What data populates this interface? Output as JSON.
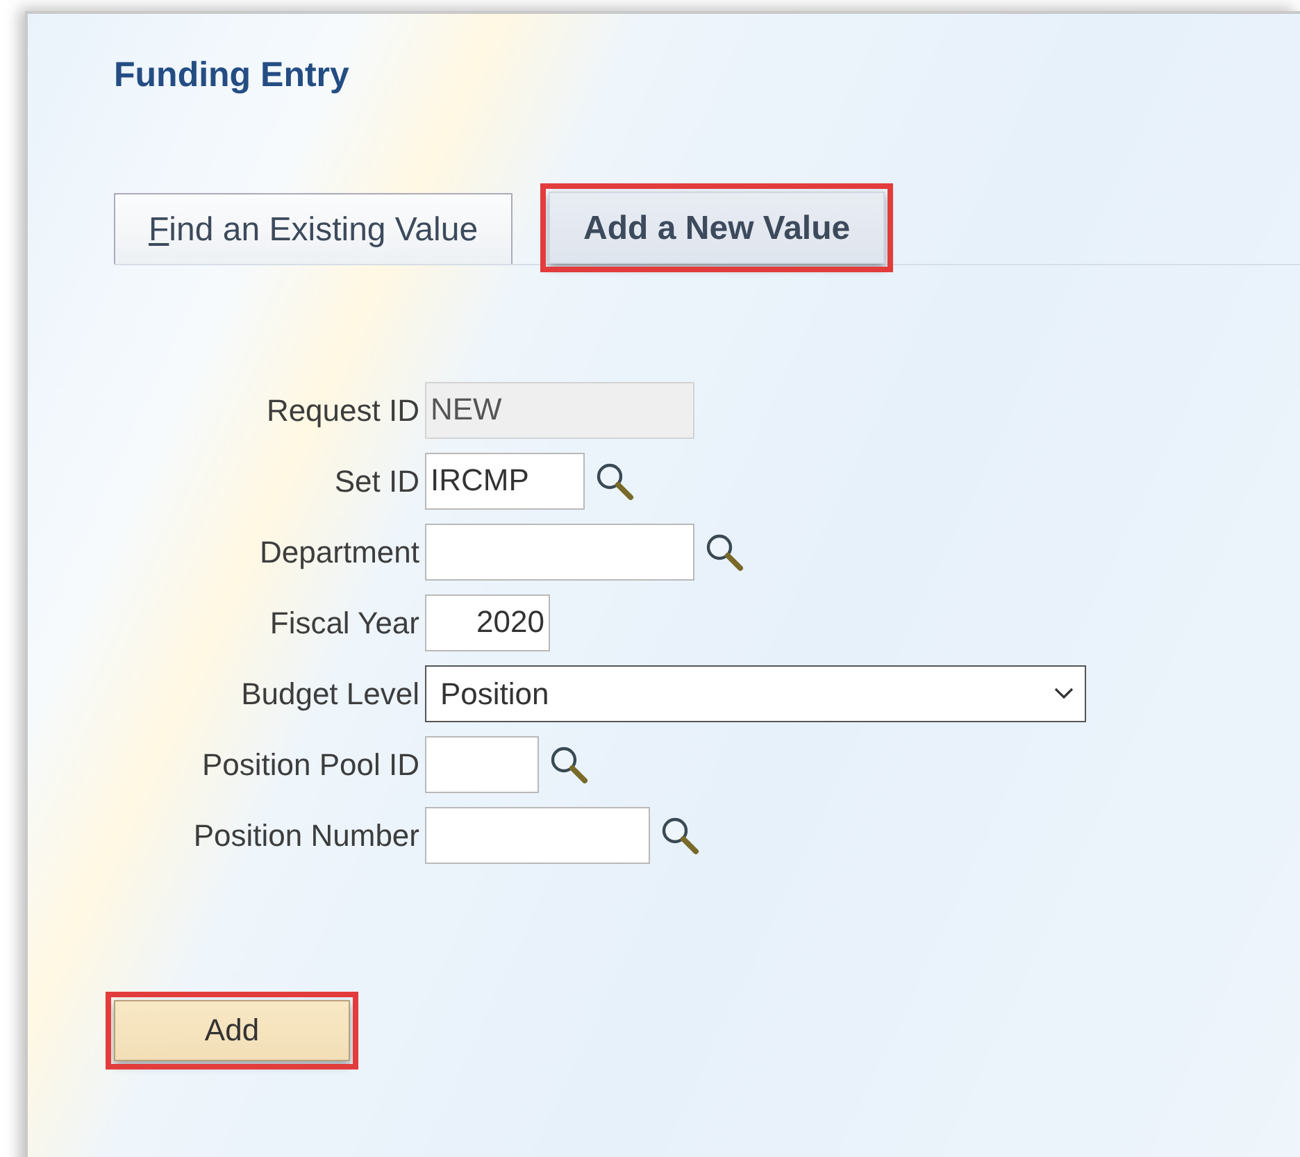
{
  "page": {
    "title": "Funding Entry"
  },
  "tabs": [
    {
      "label": "Find an Existing Value",
      "selected": false,
      "highlighted": false,
      "mnemonic_underlined": true
    },
    {
      "label": "Add a New Value",
      "selected": true,
      "highlighted": true,
      "mnemonic_underlined": false
    }
  ],
  "fields": [
    {
      "label": "Request ID",
      "kind": "text",
      "value": "NEW",
      "disabled": true,
      "lookup": false
    },
    {
      "label": "Set ID",
      "kind": "text",
      "value": "IRCMP",
      "disabled": false,
      "lookup": true
    },
    {
      "label": "Department",
      "kind": "text",
      "disabled": false,
      "lookup": true
    },
    {
      "label": "Fiscal Year",
      "kind": "text",
      "value": "2020",
      "disabled": false,
      "lookup": false
    },
    {
      "label": "Budget Level",
      "kind": "select",
      "value": "Position",
      "disabled": false,
      "lookup": false
    },
    {
      "label": "Position Pool ID",
      "kind": "text",
      "disabled": false,
      "lookup": true
    },
    {
      "label": "Position Number",
      "kind": "text",
      "disabled": false,
      "lookup": true
    }
  ],
  "add_button": {
    "label": "Add",
    "highlighted": true
  }
}
